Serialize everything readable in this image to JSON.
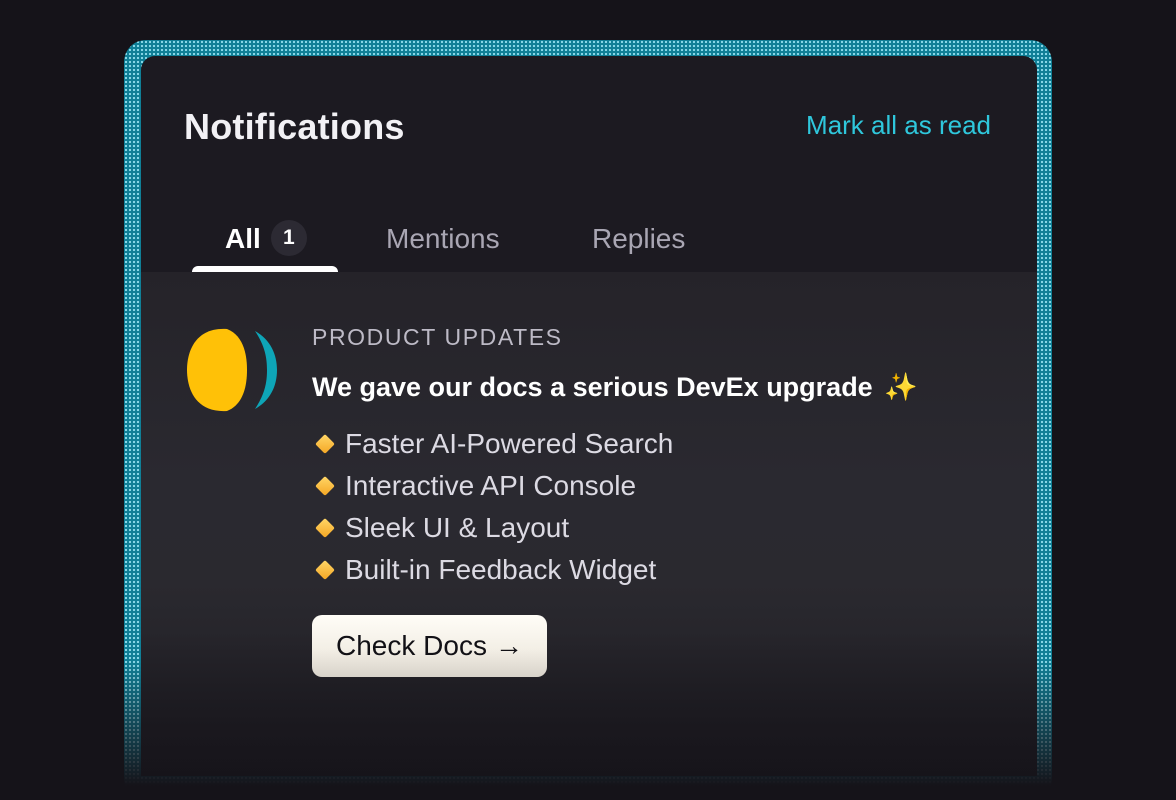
{
  "header": {
    "title": "Notifications",
    "mark_all_label": "Mark all as read"
  },
  "tabs": [
    {
      "label": "All",
      "badge": "1",
      "active": true
    },
    {
      "label": "Mentions"
    },
    {
      "label": "Replies"
    }
  ],
  "notification": {
    "category": "PRODUCT UPDATES",
    "headline": "We gave our docs a serious DevEx upgrade",
    "headline_emoji": "✨",
    "features": [
      "Faster AI-Powered Search",
      "Interactive API Console",
      "Sleek UI & Layout",
      "Built-in Feedback Widget"
    ],
    "cta_label": "Check Docs",
    "cta_arrow": "→"
  },
  "colors": {
    "accent": "#2fc7dc",
    "frame": "#0f7f96",
    "logo_yellow": "#ffc107",
    "logo_teal": "#0ea5b7"
  },
  "icons": {
    "logo": "brand-logo-icon",
    "bullet": "diamond-icon",
    "cta": "arrow-right-icon"
  }
}
